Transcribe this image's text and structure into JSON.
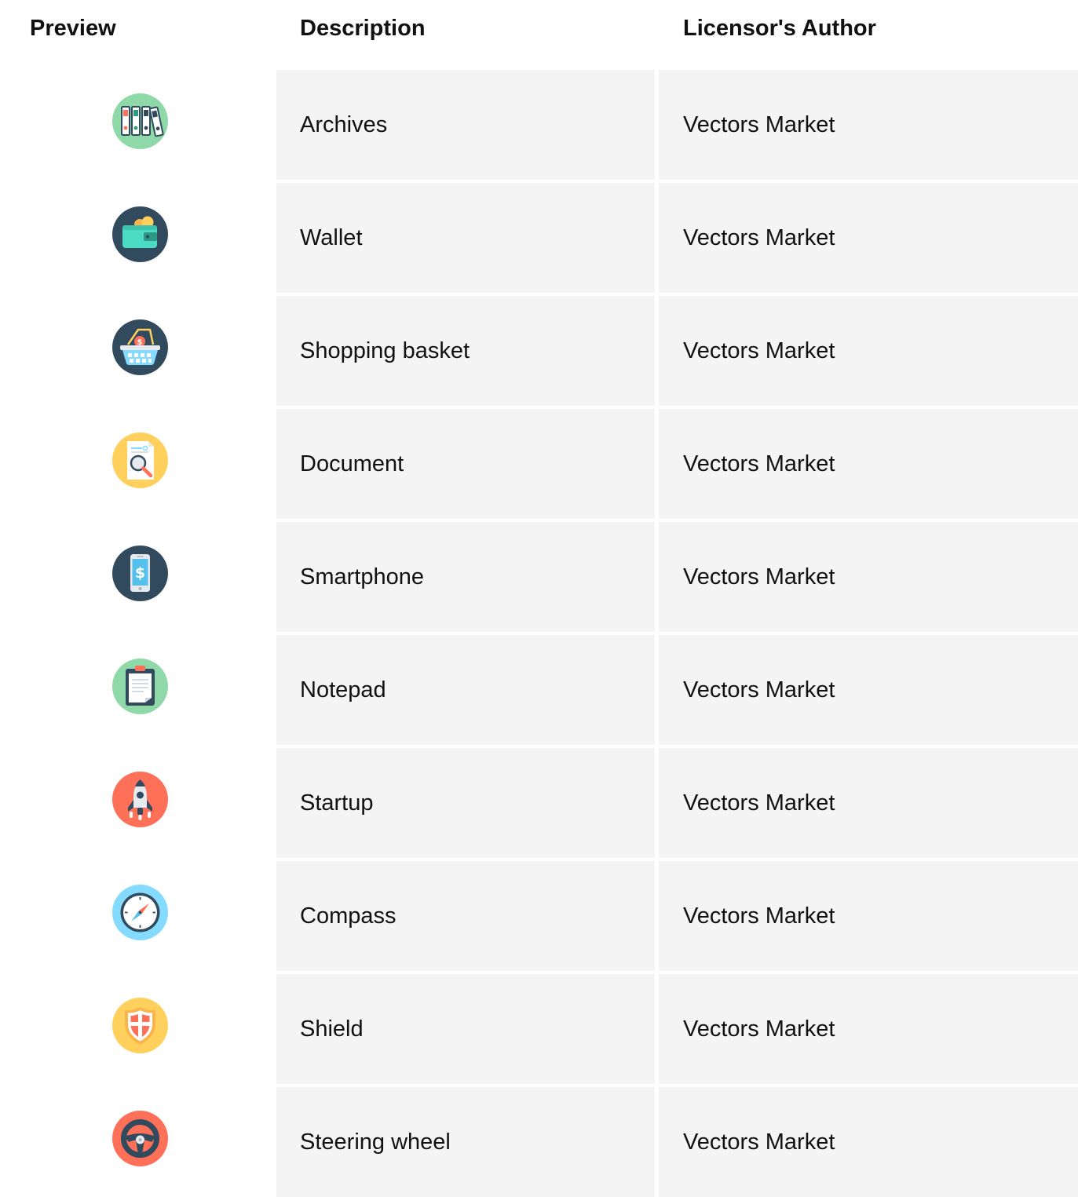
{
  "table": {
    "headers": {
      "preview": "Preview",
      "description": "Description",
      "author": "Licensor's Author"
    },
    "rows": [
      {
        "icon": "archives-icon",
        "description": "Archives",
        "author": "Vectors Market"
      },
      {
        "icon": "wallet-icon",
        "description": "Wallet",
        "author": "Vectors Market"
      },
      {
        "icon": "shopping-basket-icon",
        "description": "Shopping basket",
        "author": "Vectors Market"
      },
      {
        "icon": "document-icon",
        "description": "Document",
        "author": "Vectors Market"
      },
      {
        "icon": "smartphone-icon",
        "description": "Smartphone",
        "author": "Vectors Market"
      },
      {
        "icon": "notepad-icon",
        "description": "Notepad",
        "author": "Vectors Market"
      },
      {
        "icon": "startup-icon",
        "description": "Startup",
        "author": "Vectors Market"
      },
      {
        "icon": "compass-icon",
        "description": "Compass",
        "author": "Vectors Market"
      },
      {
        "icon": "shield-icon",
        "description": "Shield",
        "author": "Vectors Market"
      },
      {
        "icon": "steering-wheel-icon",
        "description": "Steering wheel",
        "author": "Vectors Market"
      }
    ]
  },
  "colors": {
    "row_background": "#f4f4f4",
    "icon_green": "#8fd9a8",
    "icon_navy": "#324a5e",
    "icon_yellow": "#ffd05b",
    "icon_coral": "#ff7058",
    "icon_sky": "#84dbff"
  }
}
